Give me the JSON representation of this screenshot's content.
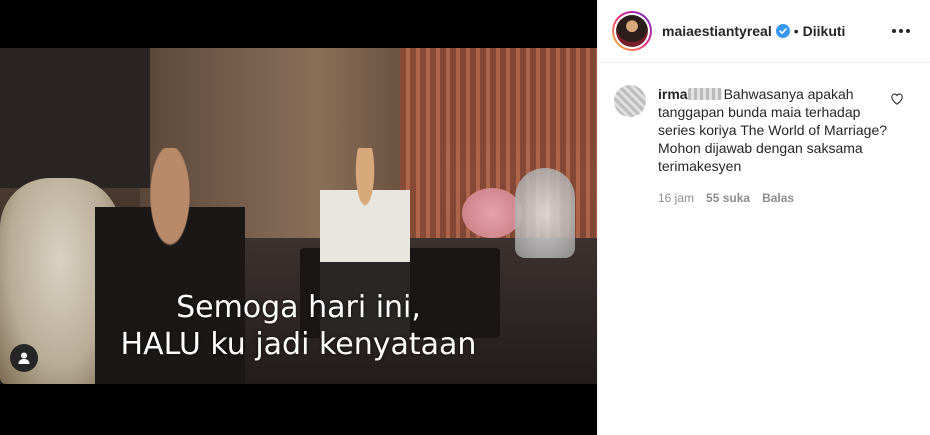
{
  "video": {
    "caption_line1": "Semoga hari ini,",
    "caption_line2": "HALU ku jadi kenyataan"
  },
  "post_header": {
    "username": "maiaestiantyreal",
    "verified": true,
    "separator": "•",
    "follow_status": "Diikuti",
    "ring_colors": [
      "#f9ce34",
      "#ee2a7b",
      "#6228d7"
    ]
  },
  "comment": {
    "username_prefix": "irma",
    "text": "Bahwasanya apakah tanggapan bunda maia terhadap series koriya The World of Marriage? Mohon dijawab dengan saksama terimakesyen",
    "time": "16 jam",
    "likes": "55 suka",
    "reply_label": "Balas"
  },
  "icons": {
    "user_tag": "user-tag-icon",
    "verified": "verified-badge-icon",
    "more": "more-options-icon",
    "like": "heart-icon"
  },
  "colors": {
    "verified_blue": "#3897f0",
    "text_primary": "#262626",
    "text_secondary": "#8e8e8e"
  }
}
